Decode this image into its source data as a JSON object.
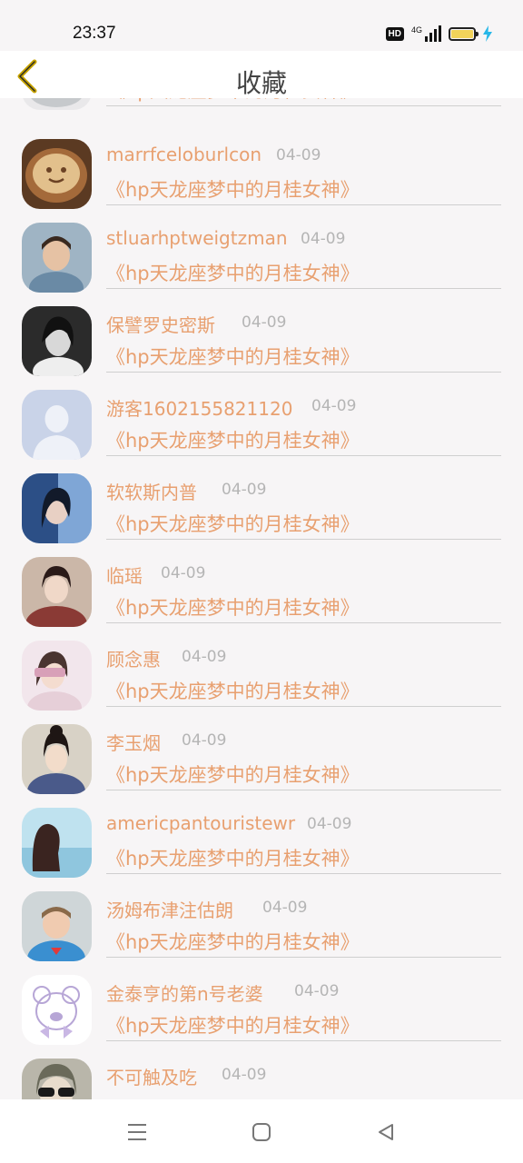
{
  "status_bar": {
    "time": "23:37",
    "hd_label": "HD",
    "network_label": "4G",
    "battery_color": "#f2d35a",
    "icons": [
      "hd-icon",
      "signal-icon",
      "battery-icon",
      "charging-icon"
    ]
  },
  "header": {
    "title": "收藏",
    "back_icon": "chevron-left-icon",
    "back_icon_color": "#c8a400"
  },
  "accent_color": "#e8a070",
  "items": [
    {
      "name": "",
      "date": "",
      "title": "《hp天龙座梦中的月桂女神》",
      "avatar": "avatar-photo",
      "avatar_color": "#c6c9cc"
    },
    {
      "name": "marrfceloburlcon",
      "date": "04-09",
      "title": "《hp天龙座梦中的月桂女神》",
      "avatar": "coffee-latte-art",
      "avatar_color": "#a46a3a"
    },
    {
      "name": "stluarhptweigtzman",
      "date": "04-09",
      "title": "《hp天龙座梦中的月桂女神》",
      "avatar": "child-photo",
      "avatar_color": "#6a8aa5"
    },
    {
      "name": "保譬罗史密斯",
      "date": "04-09",
      "title": "《hp天龙座梦中的月桂女神》",
      "avatar": "bw-portrait",
      "avatar_color": "#555555"
    },
    {
      "name": "游客1602155821120",
      "date": "04-09",
      "title": "《hp天龙座梦中的月桂女神》",
      "avatar": "default-user-icon",
      "avatar_color": "#c9d3e8"
    },
    {
      "name": "软软斯内普",
      "date": "04-09",
      "title": "《hp天龙座梦中的月桂女神》",
      "avatar": "blue-portrait",
      "avatar_color": "#2c4f86"
    },
    {
      "name": "临瑶",
      "date": "04-09",
      "title": "《hp天龙座梦中的月桂女神》",
      "avatar": "costume-portrait",
      "avatar_color": "#8a3a35"
    },
    {
      "name": "顾念惠",
      "date": "04-09",
      "title": "《hp天龙座梦中的月桂女神》",
      "avatar": "pastel-portrait",
      "avatar_color": "#e6cfd8"
    },
    {
      "name": "李玉烟",
      "date": "04-09",
      "title": "《hp天龙座梦中的月桂女神》",
      "avatar": "costume-portrait",
      "avatar_color": "#4a5a8a"
    },
    {
      "name": "americpantouristewr",
      "date": "04-09",
      "title": "《hp天龙座梦中的月桂女神》",
      "avatar": "sea-portrait",
      "avatar_color": "#8fc6de"
    },
    {
      "name": "汤姆布津注估朗",
      "date": "04-09",
      "title": "《hp天龙座梦中的月桂女神》",
      "avatar": "child-superman",
      "avatar_color": "#3a8fd0"
    },
    {
      "name": "金泰亨的第n号老婆",
      "date": "04-09",
      "title": "《hp天龙座梦中的月桂女神》",
      "avatar": "bear-sketch",
      "avatar_color": "#b7a6d6"
    },
    {
      "name": "不可触及吃",
      "date": "04-09",
      "title": "",
      "avatar": "sunglasses-portrait",
      "avatar_color": "#6a6a5a"
    }
  ],
  "nav_bar": {
    "icons": [
      "menu-icon",
      "home-square-icon",
      "back-triangle-icon"
    ]
  }
}
